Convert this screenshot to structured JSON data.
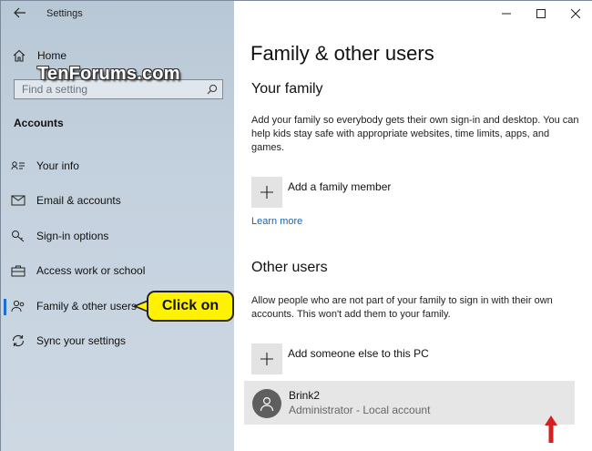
{
  "window": {
    "title": "Settings"
  },
  "sidebar": {
    "home_label": "Home",
    "watermark": "TenForums.com",
    "search_placeholder": "Find a setting",
    "section_title": "Accounts",
    "items": [
      {
        "label": "Your info",
        "icon": "person-card-icon"
      },
      {
        "label": "Email & accounts",
        "icon": "mail-icon"
      },
      {
        "label": "Sign-in options",
        "icon": "key-icon"
      },
      {
        "label": "Access work or school",
        "icon": "briefcase-icon"
      },
      {
        "label": "Family & other users",
        "icon": "people-icon",
        "selected": true
      },
      {
        "label": "Sync your settings",
        "icon": "sync-icon"
      }
    ]
  },
  "callout": {
    "text": "Click on"
  },
  "main": {
    "title": "Family & other users",
    "family": {
      "heading": "Your family",
      "description": "Add your family so everybody gets their own sign-in and desktop. You can help kids stay safe with appropriate websites, time limits, apps, and games.",
      "add_label": "Add a family member",
      "learn_more": "Learn more"
    },
    "other": {
      "heading": "Other users",
      "description": "Allow people who are not part of your family to sign in with their own accounts. This won't add them to your family.",
      "add_label": "Add someone else to this PC"
    },
    "user": {
      "name": "Brink2",
      "role": "Administrator - Local account"
    }
  },
  "colors": {
    "accent": "#1a6fd1",
    "callout": "#fff200",
    "arrow": "#d61f1f",
    "link": "#1a64b8"
  }
}
